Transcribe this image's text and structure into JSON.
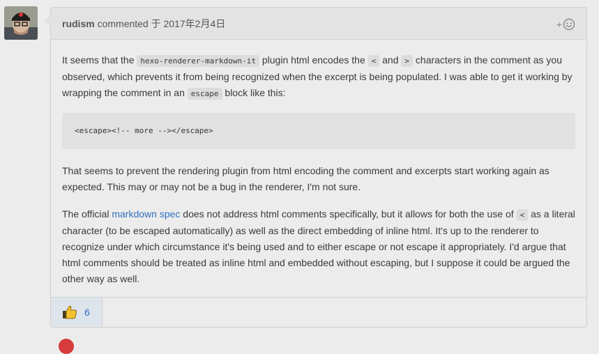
{
  "comment": {
    "author": "rudism",
    "action": " commented ",
    "date": "于 2017年2月4日",
    "reaction_button": {
      "icon": "smiley-icon",
      "plus": "+"
    },
    "body": {
      "p1": {
        "t1": "It seems that the ",
        "c1": "hexo-renderer-markdown-it",
        "t2": " plugin html encodes the ",
        "c2": "<",
        "t3": " and ",
        "c3": ">",
        "t4": " characters in the comment as you observed, which prevents it from being recognized when the excerpt is being populated. I was able to get it working by wrapping the comment in an ",
        "c4": "escape",
        "t5": " block like this:"
      },
      "code_block": "<escape><!-- more --></escape>",
      "p2": "That seems to prevent the rendering plugin from html encoding the comment and excerpts start working again as expected. This may or may not be a bug in the renderer, I'm not sure.",
      "p3": {
        "t1": "The official ",
        "link": "markdown spec",
        "t2": " does not address html comments specifically, but it allows for both the use of ",
        "c1": "<",
        "t3": " as a literal character (to be escaped automatically) as well as the direct embedding of inline html. It's up to the renderer to recognize under which circumstance it's being used and to either escape or not escape it appropriately. I'd argue that html comments should be treated as inline html and embedded without escaping, but I suppose it could be argued the other way as well."
      }
    },
    "reactions": [
      {
        "icon": "thumbs-up-icon",
        "count": "6"
      }
    ]
  }
}
